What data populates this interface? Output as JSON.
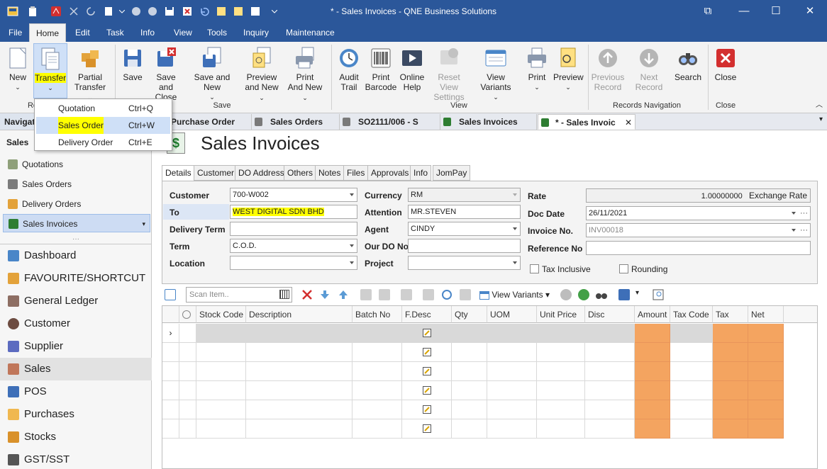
{
  "window": {
    "title": "* - Sales Invoices - QNE Business Solutions"
  },
  "menu": {
    "items": [
      "File",
      "Home",
      "Edit",
      "Task",
      "Info",
      "View",
      "Tools",
      "Inquiry",
      "Maintenance"
    ]
  },
  "ribbon": {
    "buttons": [
      {
        "label": "New",
        "icon": "new-document-icon"
      },
      {
        "label": "Transfer",
        "icon": "transfer-icon"
      },
      {
        "label": "Partial",
        "label2": "Transfer",
        "icon": "partial-transfer-icon"
      },
      {
        "label": "Save",
        "icon": "save-icon"
      },
      {
        "label": "Save and",
        "label2": "Close",
        "icon": "save-close-icon"
      },
      {
        "label": "Save and New",
        "icon": "save-new-icon"
      },
      {
        "label": "Preview",
        "label2": "and New",
        "icon": "preview-new-icon"
      },
      {
        "label": "Print",
        "label2": "And New",
        "icon": "print-new-icon"
      },
      {
        "label": "Audit",
        "label2": "Trail",
        "icon": "audit-trail-icon"
      },
      {
        "label": "Print",
        "label2": "Barcode",
        "icon": "barcode-icon"
      },
      {
        "label": "Online",
        "label2": "Help",
        "icon": "help-icon"
      },
      {
        "label": "Reset View",
        "label2": "Settings",
        "icon": "reset-view-icon"
      },
      {
        "label": "View Variants",
        "icon": "view-variants-icon"
      },
      {
        "label": "Print",
        "icon": "print-icon"
      },
      {
        "label": "Preview",
        "icon": "preview-icon"
      },
      {
        "label": "Previous",
        "label2": "Record",
        "icon": "previous-record-icon"
      },
      {
        "label": "Next Record",
        "icon": "next-record-icon"
      },
      {
        "label": "Search",
        "icon": "search-icon"
      },
      {
        "label": "Close",
        "icon": "close-icon"
      }
    ],
    "groups": {
      "records_partial": "Re",
      "save": "Save",
      "view": "View",
      "records_navigation": "Records Navigation",
      "close": "Close"
    }
  },
  "transfer_menu": {
    "items": [
      {
        "label": "Quotation",
        "shortcut": "Ctrl+Q"
      },
      {
        "label": "Sales Order",
        "shortcut": "Ctrl+W"
      },
      {
        "label": "Delivery Order",
        "shortcut": "Ctrl+E"
      }
    ]
  },
  "nav": {
    "header": "Navigat",
    "section": "Sales",
    "sub_items": [
      "Quotations",
      "Sales Orders",
      "Delivery Orders",
      "Sales Invoices"
    ],
    "modules": [
      "Dashboard",
      "FAVOURITE/SHORTCUT",
      "General Ledger",
      "Customer",
      "Supplier",
      "Sales",
      "POS",
      "Purchases",
      "Stocks",
      "GST/SST"
    ]
  },
  "doc_tabs": [
    "Purchase Order",
    "Sales Orders",
    "SO2111/006 - S",
    "Sales Invoices",
    "* - Sales Invoic"
  ],
  "page": {
    "title": "Sales Invoices",
    "form_tabs": [
      "Details",
      "Customer",
      "DO Address",
      "Others",
      "Notes",
      "Files",
      "Approvals",
      "Info",
      "JomPay"
    ]
  },
  "form": {
    "customer_label": "Customer",
    "customer": "700-W002",
    "to_label": "To",
    "to": "WEST DIGITAL SDN BHD",
    "delivery_term_label": "Delivery Term",
    "delivery_term": "",
    "term_label": "Term",
    "term": "C.O.D.",
    "location_label": "Location",
    "location": "",
    "currency_label": "Currency",
    "currency": "RM",
    "attention_label": "Attention",
    "attention": "MR.STEVEN",
    "agent_label": "Agent",
    "agent": "CINDY",
    "our_do_label": "Our DO No",
    "our_do": "",
    "project_label": "Project",
    "project": "",
    "rate_label": "Rate",
    "rate": "1.00000000",
    "rate_suffix": "Exchange Rate",
    "doc_date_label": "Doc Date",
    "doc_date": "26/11/2021",
    "invoice_no_label": "Invoice No.",
    "invoice_no": "INV00018",
    "reference_label": "Reference No",
    "reference": "",
    "tax_inclusive_label": "Tax Inclusive",
    "rounding_label": "Rounding"
  },
  "grid": {
    "scan_placeholder": "Scan Item..",
    "view_variants": "View Variants",
    "columns": [
      "Stock Code",
      "Description",
      "Batch No",
      "F.Desc",
      "Qty",
      "UOM",
      "Unit Price",
      "Disc",
      "Amount",
      "Tax Code",
      "Tax",
      "Net"
    ],
    "row_count": 6,
    "colors": {
      "highlight": "#f4a460",
      "selected_row": "#d9d9d9"
    }
  },
  "colors": {
    "title_bar": "#2b579a",
    "ribbon_bg": "#f3f3f3",
    "highlight": "#ffff00"
  }
}
